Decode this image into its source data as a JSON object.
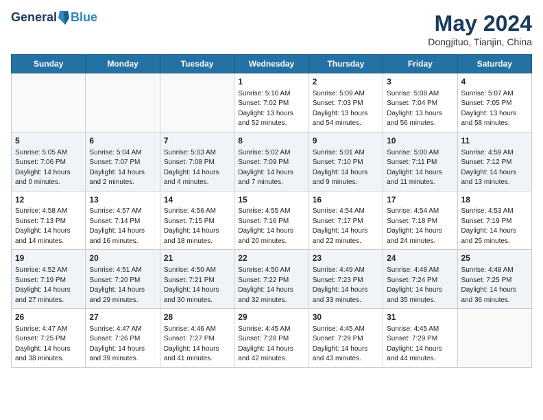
{
  "header": {
    "logo_line1": "General",
    "logo_line2": "Blue",
    "month": "May 2024",
    "location": "Dongjituo, Tianjin, China"
  },
  "days_of_week": [
    "Sunday",
    "Monday",
    "Tuesday",
    "Wednesday",
    "Thursday",
    "Friday",
    "Saturday"
  ],
  "weeks": [
    [
      {
        "day": "",
        "info": ""
      },
      {
        "day": "",
        "info": ""
      },
      {
        "day": "",
        "info": ""
      },
      {
        "day": "1",
        "info": "Sunrise: 5:10 AM\nSunset: 7:02 PM\nDaylight: 13 hours and 52 minutes."
      },
      {
        "day": "2",
        "info": "Sunrise: 5:09 AM\nSunset: 7:03 PM\nDaylight: 13 hours and 54 minutes."
      },
      {
        "day": "3",
        "info": "Sunrise: 5:08 AM\nSunset: 7:04 PM\nDaylight: 13 hours and 56 minutes."
      },
      {
        "day": "4",
        "info": "Sunrise: 5:07 AM\nSunset: 7:05 PM\nDaylight: 13 hours and 58 minutes."
      }
    ],
    [
      {
        "day": "5",
        "info": "Sunrise: 5:05 AM\nSunset: 7:06 PM\nDaylight: 14 hours and 0 minutes."
      },
      {
        "day": "6",
        "info": "Sunrise: 5:04 AM\nSunset: 7:07 PM\nDaylight: 14 hours and 2 minutes."
      },
      {
        "day": "7",
        "info": "Sunrise: 5:03 AM\nSunset: 7:08 PM\nDaylight: 14 hours and 4 minutes."
      },
      {
        "day": "8",
        "info": "Sunrise: 5:02 AM\nSunset: 7:09 PM\nDaylight: 14 hours and 7 minutes."
      },
      {
        "day": "9",
        "info": "Sunrise: 5:01 AM\nSunset: 7:10 PM\nDaylight: 14 hours and 9 minutes."
      },
      {
        "day": "10",
        "info": "Sunrise: 5:00 AM\nSunset: 7:11 PM\nDaylight: 14 hours and 11 minutes."
      },
      {
        "day": "11",
        "info": "Sunrise: 4:59 AM\nSunset: 7:12 PM\nDaylight: 14 hours and 13 minutes."
      }
    ],
    [
      {
        "day": "12",
        "info": "Sunrise: 4:58 AM\nSunset: 7:13 PM\nDaylight: 14 hours and 14 minutes."
      },
      {
        "day": "13",
        "info": "Sunrise: 4:57 AM\nSunset: 7:14 PM\nDaylight: 14 hours and 16 minutes."
      },
      {
        "day": "14",
        "info": "Sunrise: 4:56 AM\nSunset: 7:15 PM\nDaylight: 14 hours and 18 minutes."
      },
      {
        "day": "15",
        "info": "Sunrise: 4:55 AM\nSunset: 7:16 PM\nDaylight: 14 hours and 20 minutes."
      },
      {
        "day": "16",
        "info": "Sunrise: 4:54 AM\nSunset: 7:17 PM\nDaylight: 14 hours and 22 minutes."
      },
      {
        "day": "17",
        "info": "Sunrise: 4:54 AM\nSunset: 7:18 PM\nDaylight: 14 hours and 24 minutes."
      },
      {
        "day": "18",
        "info": "Sunrise: 4:53 AM\nSunset: 7:19 PM\nDaylight: 14 hours and 25 minutes."
      }
    ],
    [
      {
        "day": "19",
        "info": "Sunrise: 4:52 AM\nSunset: 7:19 PM\nDaylight: 14 hours and 27 minutes."
      },
      {
        "day": "20",
        "info": "Sunrise: 4:51 AM\nSunset: 7:20 PM\nDaylight: 14 hours and 29 minutes."
      },
      {
        "day": "21",
        "info": "Sunrise: 4:50 AM\nSunset: 7:21 PM\nDaylight: 14 hours and 30 minutes."
      },
      {
        "day": "22",
        "info": "Sunrise: 4:50 AM\nSunset: 7:22 PM\nDaylight: 14 hours and 32 minutes."
      },
      {
        "day": "23",
        "info": "Sunrise: 4:49 AM\nSunset: 7:23 PM\nDaylight: 14 hours and 33 minutes."
      },
      {
        "day": "24",
        "info": "Sunrise: 4:48 AM\nSunset: 7:24 PM\nDaylight: 14 hours and 35 minutes."
      },
      {
        "day": "25",
        "info": "Sunrise: 4:48 AM\nSunset: 7:25 PM\nDaylight: 14 hours and 36 minutes."
      }
    ],
    [
      {
        "day": "26",
        "info": "Sunrise: 4:47 AM\nSunset: 7:25 PM\nDaylight: 14 hours and 38 minutes."
      },
      {
        "day": "27",
        "info": "Sunrise: 4:47 AM\nSunset: 7:26 PM\nDaylight: 14 hours and 39 minutes."
      },
      {
        "day": "28",
        "info": "Sunrise: 4:46 AM\nSunset: 7:27 PM\nDaylight: 14 hours and 41 minutes."
      },
      {
        "day": "29",
        "info": "Sunrise: 4:45 AM\nSunset: 7:28 PM\nDaylight: 14 hours and 42 minutes."
      },
      {
        "day": "30",
        "info": "Sunrise: 4:45 AM\nSunset: 7:29 PM\nDaylight: 14 hours and 43 minutes."
      },
      {
        "day": "31",
        "info": "Sunrise: 4:45 AM\nSunset: 7:29 PM\nDaylight: 14 hours and 44 minutes."
      },
      {
        "day": "",
        "info": ""
      }
    ]
  ]
}
